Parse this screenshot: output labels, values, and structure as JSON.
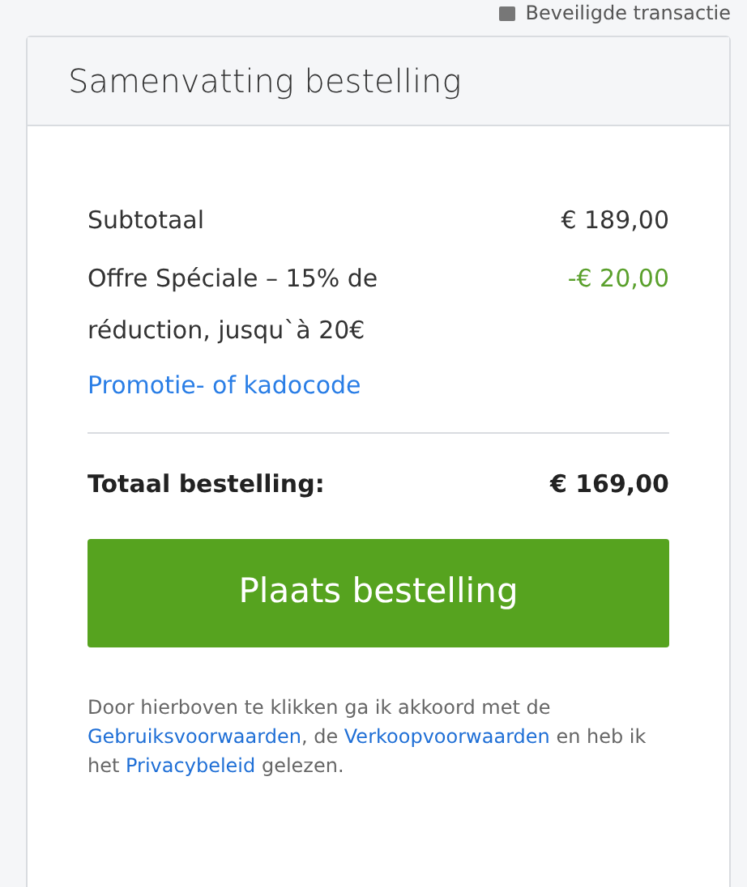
{
  "secure_note": "Beveiligde transactie",
  "card": {
    "title": "Samenvatting bestelling",
    "lines": [
      {
        "label": "Subtotaal",
        "amount": "€ 189,00",
        "kind": "normal"
      },
      {
        "label": "Offre Spéciale – 15% de réduction, jusqu`à 20€",
        "amount": "-€ 20,00",
        "kind": "discount"
      }
    ],
    "promo_link": "Promotie- of kadocode",
    "total": {
      "label": "Totaal bestelling:",
      "amount": "€ 169,00"
    },
    "button": "Plaats bestelling",
    "legal": [
      {
        "kind": "text",
        "text": "Door hierboven te klikken ga ik akkoord met de "
      },
      {
        "kind": "link",
        "text": "Gebruiksvoorwaarden"
      },
      {
        "kind": "text",
        "text": ", de "
      },
      {
        "kind": "link",
        "text": "Verkoopvoorwaarden"
      },
      {
        "kind": "text",
        "text": " en heb ik het "
      },
      {
        "kind": "link",
        "text": "Privacybeleid"
      },
      {
        "kind": "text",
        "text": " gelezen."
      }
    ]
  }
}
